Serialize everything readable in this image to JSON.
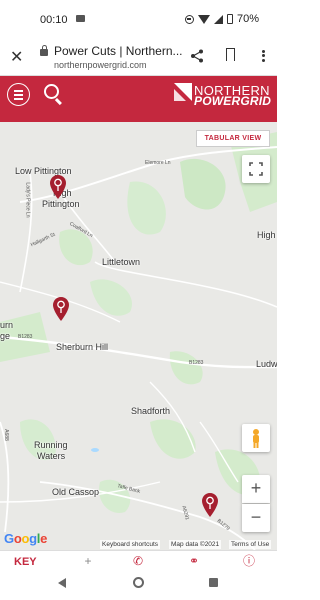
{
  "status": {
    "time": "00:10",
    "battery": "70%"
  },
  "browser": {
    "title": "Power Cuts | Northern...",
    "url": "northernpowergrid.com"
  },
  "header": {
    "logo_line1": "NORTHERN",
    "logo_line2": "POWERGRID",
    "brand_color": "#c4283e"
  },
  "map": {
    "tabular_button": "TABULAR VIEW",
    "places": {
      "low_pittington": "Low Pittington",
      "high_pittington_1": "High",
      "high_pittington_2": "Pittington",
      "high_right": "High",
      "littletown": "Littletown",
      "sherburn_1": "urn",
      "sherburn_2": "ge",
      "sherburn_hill": "Sherburn Hill",
      "shadforth": "Shadforth",
      "ludw": "Ludw",
      "running_waters_1": "Running",
      "running_waters_2": "Waters",
      "old_cassop": "Old Cassop"
    },
    "roads": {
      "elemore": "Elemore Ln",
      "hallgarth": "Hallgarth St",
      "coalford": "Coalford Ln",
      "lady_piece": "Lady's Piece Ln",
      "b1283_a": "B1283",
      "b1283_b": "B1283",
      "a688": "A688",
      "b1279": "B1279",
      "tafle_bank": "Tafle Bank",
      "a6291": "A6291"
    },
    "zoom_in": "+",
    "zoom_out": "−",
    "google": [
      "G",
      "o",
      "o",
      "g",
      "l",
      "e"
    ],
    "attribution": {
      "shortcuts": "Keyboard shortcuts",
      "map_data": "Map data ©2021",
      "terms": "Terms of Use"
    }
  },
  "bottom_bar": {
    "key_label": "KEY"
  }
}
